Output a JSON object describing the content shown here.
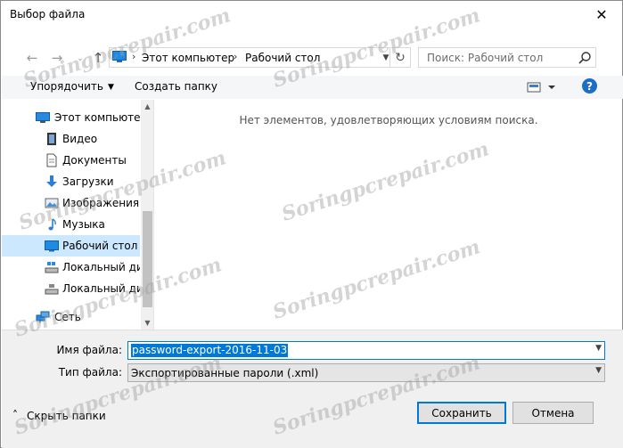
{
  "window": {
    "title": "Выбор файла"
  },
  "address": {
    "crumbs": [
      "Этот компьютер",
      "Рабочий стол"
    ],
    "separator": "›"
  },
  "search": {
    "placeholder": "Поиск: Рабочий стол"
  },
  "toolbar": {
    "organize_label": "Упорядочить",
    "new_folder_label": "Создать папку",
    "help_label": "?"
  },
  "nav": {
    "items": [
      {
        "label": "Этот компьютер",
        "icon": "computer-icon"
      },
      {
        "label": "Видео",
        "icon": "video-icon"
      },
      {
        "label": "Документы",
        "icon": "documents-icon"
      },
      {
        "label": "Загрузки",
        "icon": "downloads-icon"
      },
      {
        "label": "Изображения",
        "icon": "pictures-icon"
      },
      {
        "label": "Музыка",
        "icon": "music-icon"
      },
      {
        "label": "Рабочий стол",
        "icon": "desktop-icon",
        "selected": true
      },
      {
        "label": "Локальный дис",
        "icon": "drive-icon"
      },
      {
        "label": "Локальный дис",
        "icon": "drive-icon"
      },
      {
        "label": "Сеть",
        "icon": "network-icon"
      }
    ]
  },
  "content": {
    "empty_message": "Нет элементов, удовлетворяющих условиям поиска."
  },
  "form": {
    "filename_label": "Имя файла:",
    "filename_value": "password-export-2016-11-03",
    "filetype_label": "Тип файла:",
    "filetype_value": "Экспортированные пароли (.xml)"
  },
  "footer": {
    "hide_folders_label": "Скрыть папки",
    "save_label": "Сохранить",
    "cancel_label": "Отмена"
  },
  "watermark": {
    "text": "Soringpcrepair.com"
  },
  "colors": {
    "accent": "#0078d7",
    "selection": "#cce8ff",
    "help": "#1c6fc4"
  }
}
